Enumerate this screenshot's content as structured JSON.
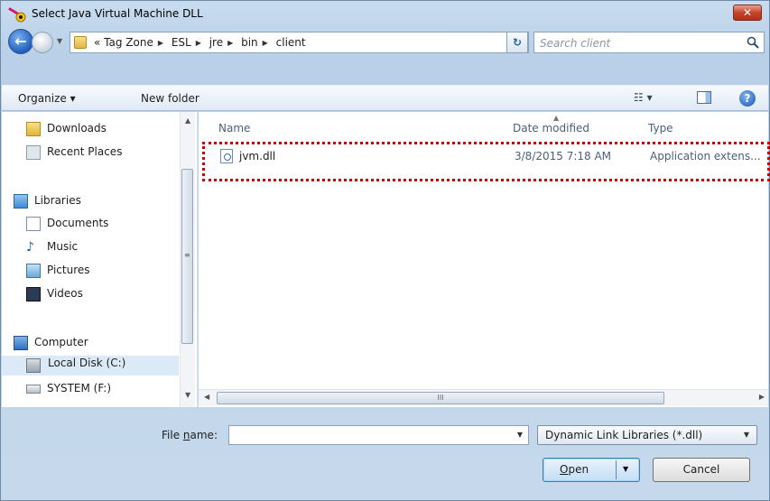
{
  "window": {
    "title": "Select Java Virtual Machine DLL",
    "close_label": "✕"
  },
  "address_bar": {
    "overflow": "«",
    "breadcrumbs": [
      "Tag Zone",
      "ESL",
      "jre",
      "bin",
      "client"
    ],
    "refresh_icon": "refresh-icon"
  },
  "search": {
    "placeholder": "Search client"
  },
  "toolbar": {
    "organize_label": "Organize ▾",
    "new_folder_label": "New folder",
    "views_label": "☷ ▾",
    "help_label": "?"
  },
  "nav_pane": {
    "items": [
      {
        "label": "Downloads",
        "icon": "downloads-folder-icon"
      },
      {
        "label": "Recent Places",
        "icon": "recent-places-icon"
      },
      {
        "label": "Libraries",
        "icon": "libraries-icon"
      },
      {
        "label": "Documents",
        "icon": "documents-icon"
      },
      {
        "label": "Music",
        "icon": "music-icon"
      },
      {
        "label": "Pictures",
        "icon": "pictures-icon"
      },
      {
        "label": "Videos",
        "icon": "videos-icon"
      },
      {
        "label": "Computer",
        "icon": "computer-icon"
      },
      {
        "label": "Local Disk (C:)",
        "icon": "local-disk-icon",
        "selected": true
      },
      {
        "label": "SYSTEM (F:)",
        "icon": "drive-icon"
      }
    ]
  },
  "file_list": {
    "columns": [
      "Name",
      "Date modified",
      "Type"
    ],
    "rows": [
      {
        "name": "jvm.dll",
        "date_modified": "3/8/2015 7:18 AM",
        "type": "Application extens..."
      }
    ],
    "hscroll_grip": "III"
  },
  "bottom": {
    "file_name_label_pre": "File ",
    "file_name_label_accel": "n",
    "file_name_label_post": "ame:",
    "file_name_value": "",
    "filter_value": "Dynamic Link Libraries (*.dll)",
    "open_accel": "O",
    "open_rest": "pen",
    "cancel_label": "Cancel"
  },
  "colors": {
    "highlight_border": "#cc0000",
    "selection": "#dce9f7"
  }
}
